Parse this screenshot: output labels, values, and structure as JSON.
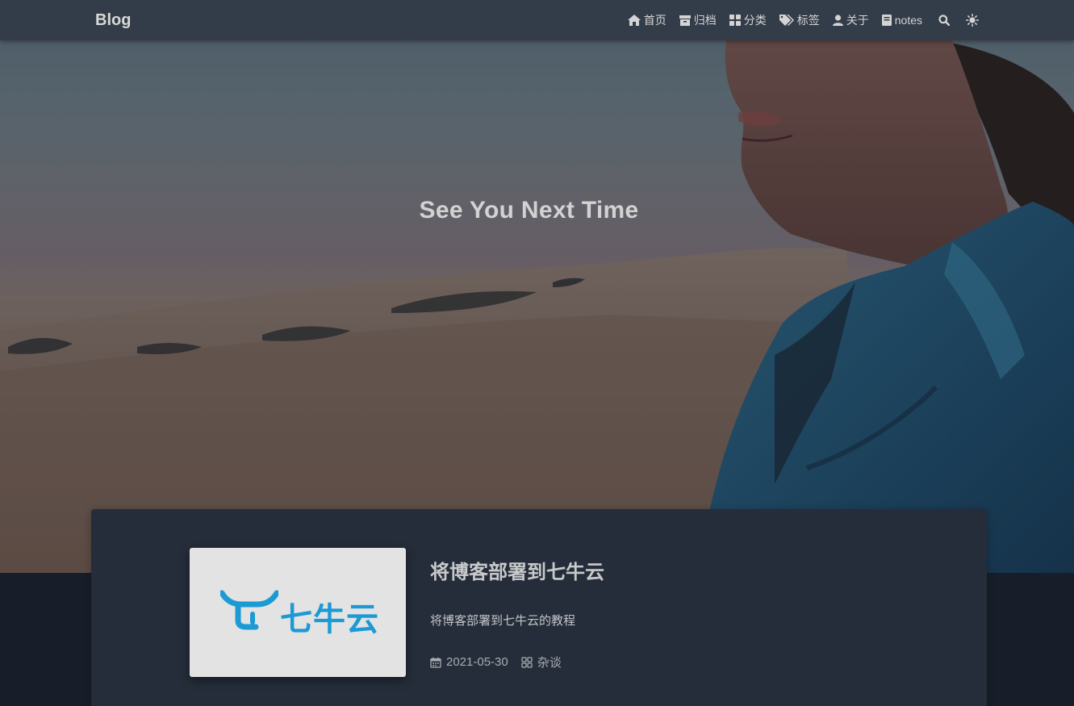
{
  "navbar": {
    "brand": "Blog",
    "items": [
      {
        "label": "首页",
        "icon": "home-icon"
      },
      {
        "label": "归档",
        "icon": "archive-icon"
      },
      {
        "label": "分类",
        "icon": "categories-icon"
      },
      {
        "label": "标签",
        "icon": "tags-icon"
      },
      {
        "label": "关于",
        "icon": "user-icon"
      },
      {
        "label": "notes",
        "icon": "book-icon"
      }
    ],
    "search_icon": "search-icon",
    "theme_icon": "sun-icon"
  },
  "hero": {
    "title": "See You Next Time"
  },
  "post": {
    "title": "将博客部署到七牛云",
    "excerpt": "将博客部署到七牛云的教程",
    "date": "2021-05-30",
    "category": "杂谈",
    "thumbnail_text": "七牛云"
  },
  "colors": {
    "page_bg": "#181e29",
    "card_bg": "#252d3a",
    "navbar_bg": "#303844",
    "qiniu_blue": "#1b9ad4"
  }
}
